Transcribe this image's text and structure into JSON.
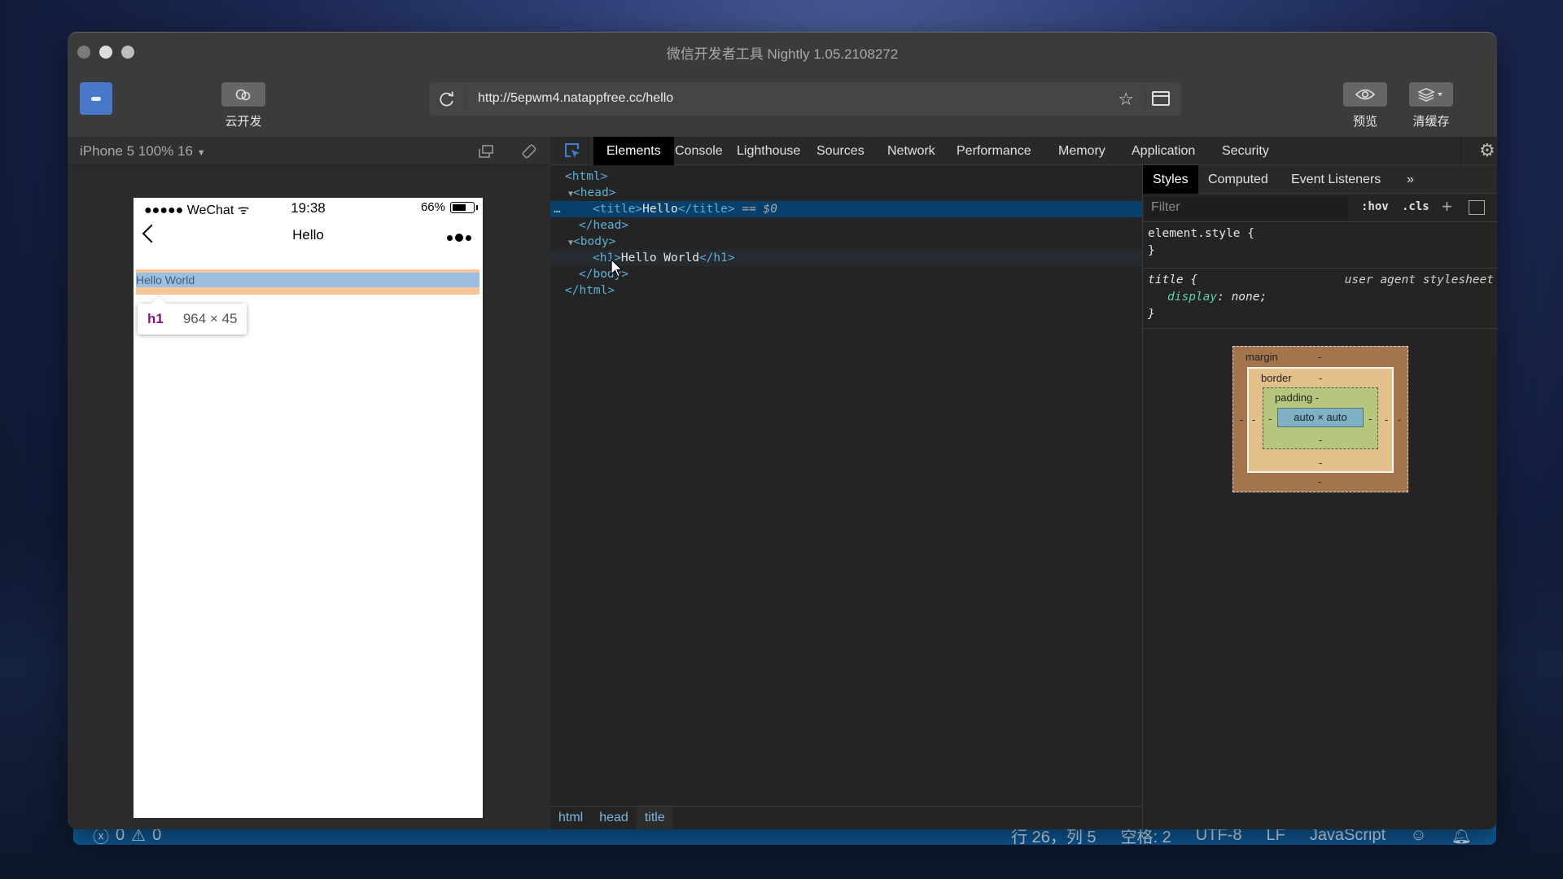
{
  "window": {
    "title": "微信开发者工具 Nightly 1.05.2108272"
  },
  "toolbar": {
    "cloud_dev_label": "云开发",
    "url": "http://5epwm4.natappfree.cc/hello",
    "preview_label": "预览",
    "clear_cache_label": "清缓存"
  },
  "simulator": {
    "device_label": "iPhone 5 100% 16",
    "phone": {
      "carrier": "●●●●● WeChat",
      "time": "19:38",
      "battery_percent_label": "66%",
      "battery_level": 0.66,
      "nav_title": "Hello",
      "highlighted_text": "Hello World",
      "tooltip_tag": "h1",
      "tooltip_dimensions": "964 × 45"
    }
  },
  "devtools": {
    "tabs": [
      "Elements",
      "Console",
      "Lighthouse",
      "Sources",
      "Network",
      "Performance",
      "Memory",
      "Application",
      "Security"
    ],
    "active_tab": "Elements",
    "dom_tree": {
      "html_open": "<html>",
      "head_open": "<head>",
      "title_open": "<title>",
      "title_text": "Hello",
      "title_close": "</title>",
      "selected_marker": "== $0",
      "head_close": "</head>",
      "body_open": "<body>",
      "h1_open": "<h1>",
      "h1_text": "Hello World",
      "h1_close": "</h1>",
      "body_close": "</body>",
      "html_close": "</html>"
    },
    "breadcrumbs": [
      "html",
      "head",
      "title"
    ],
    "styles_panel": {
      "tabs": [
        "Styles",
        "Computed",
        "Event Listeners"
      ],
      "active_tab": "Styles",
      "more_label": "»",
      "filter_placeholder": "Filter",
      "hov_label": ":hov",
      "cls_label": ".cls",
      "plus_label": "+",
      "rules": [
        {
          "selector": "element.style {",
          "close": "}"
        },
        {
          "selector": "title {",
          "source": "user agent stylesheet",
          "property": "display",
          "value": "none;",
          "close": "}"
        }
      ],
      "box_model": {
        "margin_label": "margin",
        "border_label": "border",
        "padding_label": "padding -",
        "content": "auto × auto",
        "dash": "-"
      }
    }
  },
  "statusbar": {
    "errors": "0",
    "warnings": "0",
    "position": "行 26，列 5",
    "indent": "空格: 2",
    "encoding": "UTF-8",
    "eol": "LF",
    "language": "JavaScript"
  },
  "colors": {
    "accent_blue": "#3d7ed1",
    "selection_bg": "#093f6b",
    "statusbar_bg": "#0f5a98",
    "highlight_margin": "#f6c69a",
    "highlight_content": "#9cbfe0"
  }
}
